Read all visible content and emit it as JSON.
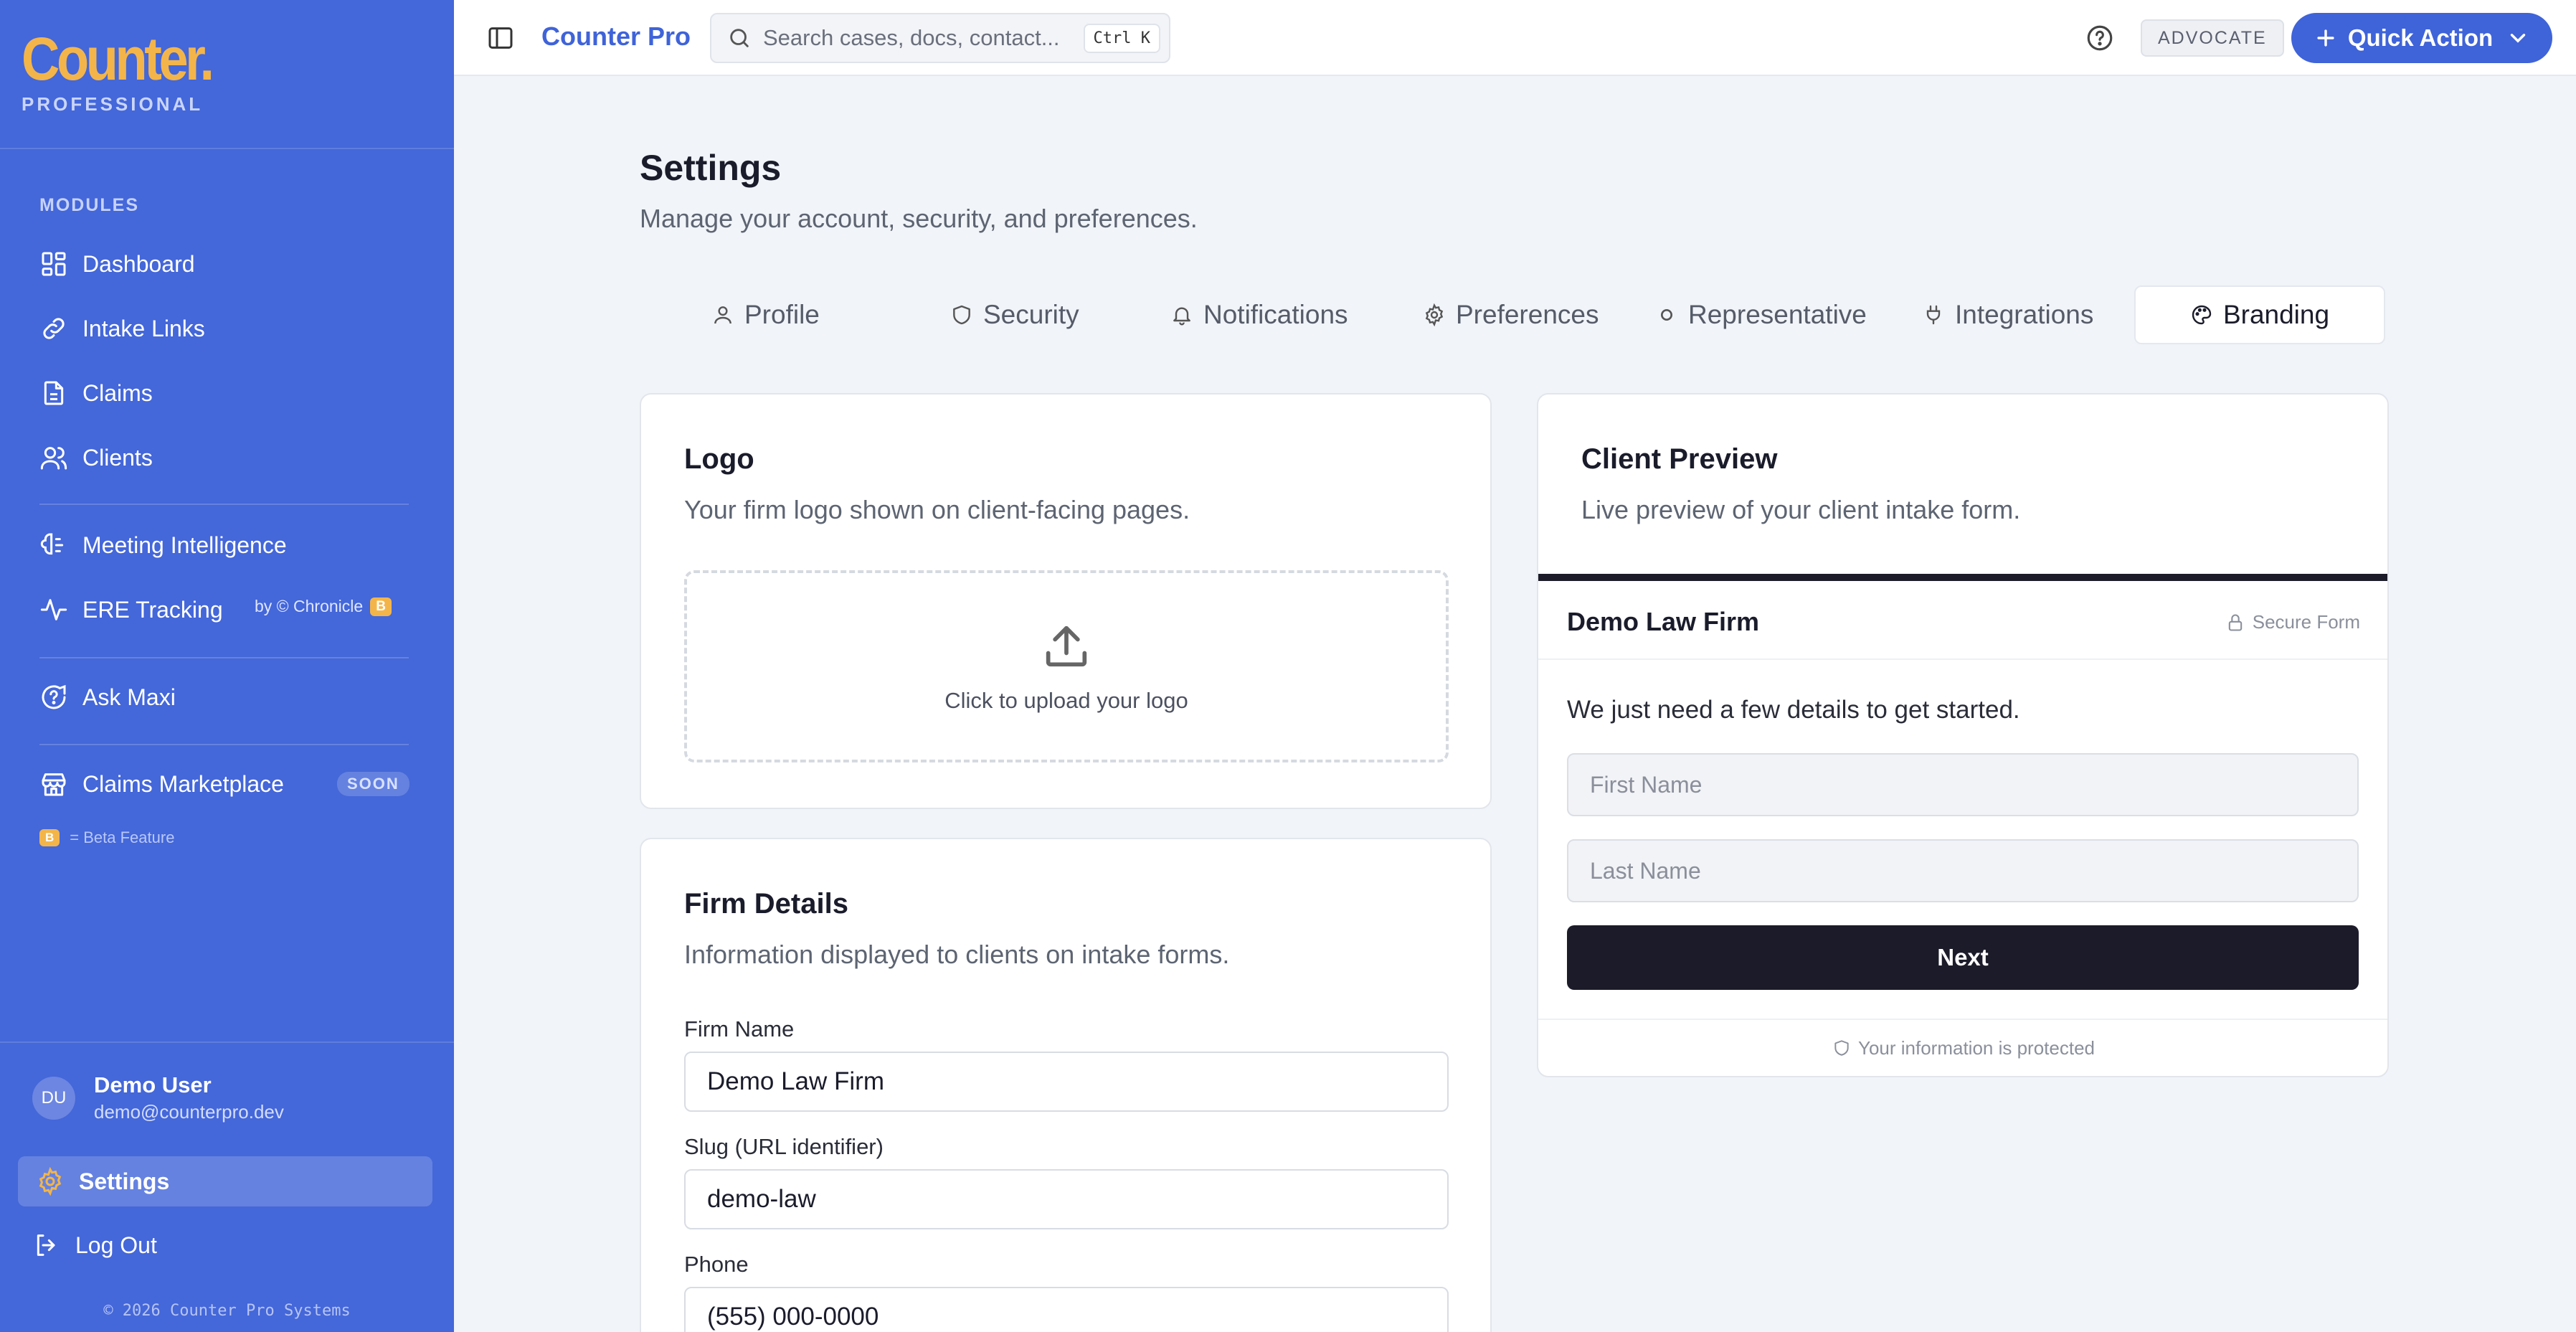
{
  "sidebar": {
    "brand_logo": "Counter.",
    "brand_sub": "PROFESSIONAL",
    "section_label": "MODULES",
    "items": [
      {
        "label": "Dashboard"
      },
      {
        "label": "Intake Links"
      },
      {
        "label": "Claims"
      },
      {
        "label": "Clients"
      },
      {
        "label": "Meeting Intelligence"
      },
      {
        "label": "ERE Tracking"
      },
      {
        "label": "Ask Maxi"
      },
      {
        "label": "Claims Marketplace"
      }
    ],
    "ere_byline": "by © Chronicle",
    "beta_badge": "B",
    "soon_badge": "SOON",
    "beta_legend": "= Beta Feature",
    "user": {
      "initials": "DU",
      "name": "Demo User",
      "email": "demo@counterpro.dev"
    },
    "settings_label": "Settings",
    "logout_label": "Log Out",
    "copyright": "© 2026 Counter Pro Systems"
  },
  "topbar": {
    "title": "Counter Pro",
    "search_placeholder": "Search cases, docs, contact...",
    "search_shortcut": "Ctrl K",
    "role_badge": "ADVOCATE",
    "quick_action_label": "Quick Action"
  },
  "page": {
    "title": "Settings",
    "subtitle": "Manage your account, security, and preferences."
  },
  "tabs": [
    {
      "label": "Profile",
      "icon": "user-icon"
    },
    {
      "label": "Security",
      "icon": "shield-icon"
    },
    {
      "label": "Notifications",
      "icon": "bell-icon"
    },
    {
      "label": "Preferences",
      "icon": "gear-icon"
    },
    {
      "label": "Representative",
      "icon": "circle-icon"
    },
    {
      "label": "Integrations",
      "icon": "plug-icon"
    },
    {
      "label": "Branding",
      "icon": "palette-icon",
      "active": true
    }
  ],
  "logo_card": {
    "title": "Logo",
    "subtitle": "Your firm logo shown on client-facing pages.",
    "upload_label": "Click to upload your logo"
  },
  "firm_card": {
    "title": "Firm Details",
    "subtitle": "Information displayed to clients on intake forms.",
    "fields": [
      {
        "label": "Firm Name",
        "value": "Demo Law Firm"
      },
      {
        "label": "Slug (URL identifier)",
        "value": "demo-law"
      },
      {
        "label": "Phone",
        "value": "(555) 000-0000"
      }
    ]
  },
  "preview_card": {
    "title": "Client Preview",
    "subtitle": "Live preview of your client intake form.",
    "firm_name": "Demo Law Firm",
    "secure_label": "Secure Form",
    "intro": "We just need a few details to get started.",
    "first_name_placeholder": "First Name",
    "last_name_placeholder": "Last Name",
    "next_label": "Next",
    "footer": "Your information is protected"
  },
  "colors": {
    "sidebar_bg": "#4467d9",
    "accent": "#3f63d8",
    "brand_gold": "#f3b54a",
    "dark_button": "#1c1b29"
  }
}
